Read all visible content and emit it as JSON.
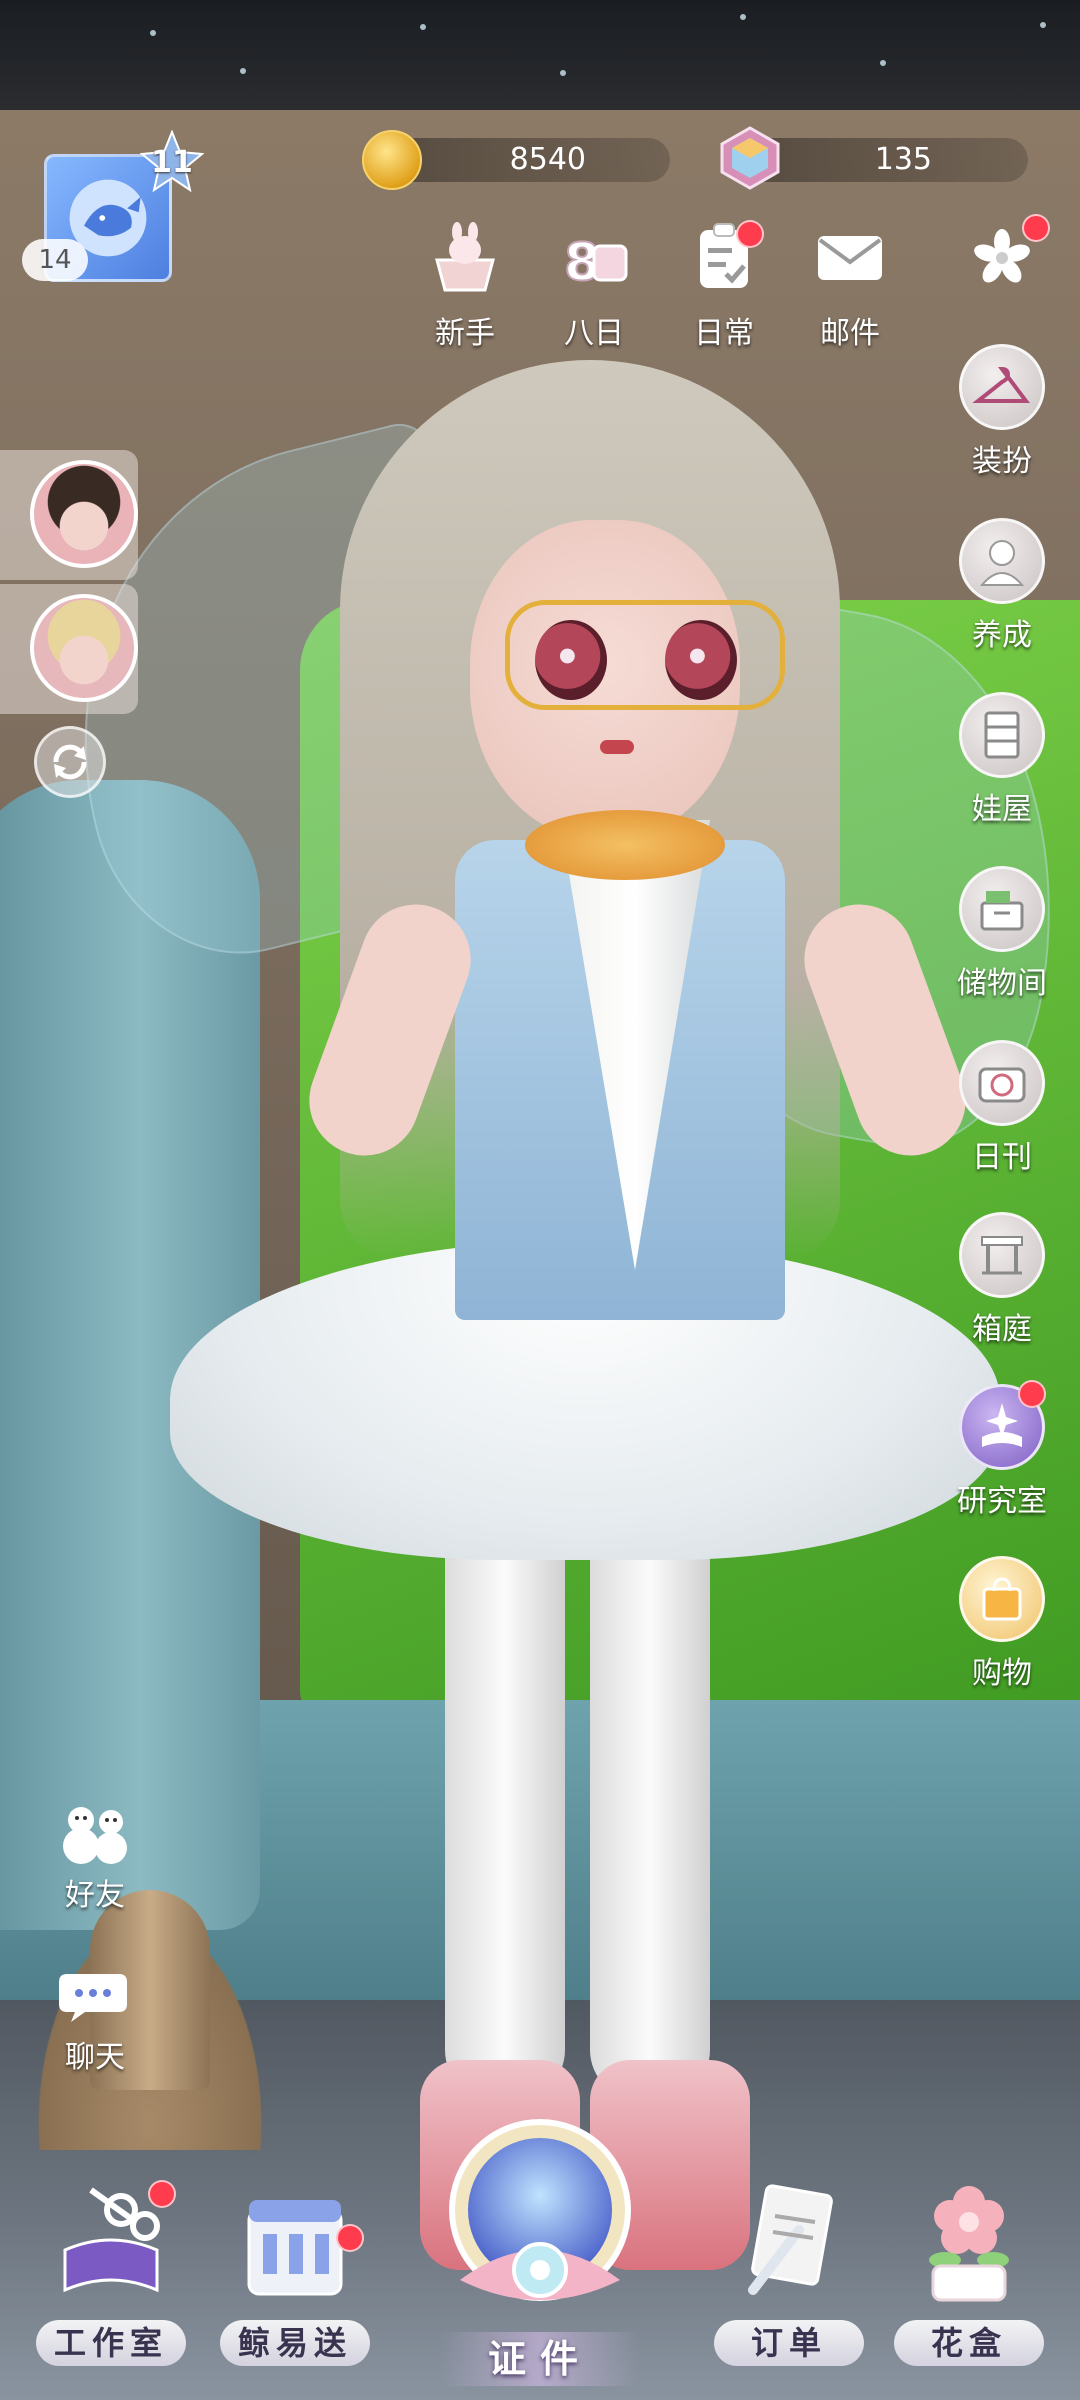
{
  "player": {
    "level": "11",
    "sub_level": "14"
  },
  "currencies": {
    "coins": "8540",
    "gems": "135"
  },
  "top_menu": [
    {
      "label": "新手",
      "icon": "gift-basket-icon",
      "badge": false
    },
    {
      "label": "八日",
      "icon": "eight-day-calendar-icon",
      "badge": false
    },
    {
      "label": "日常",
      "icon": "clipboard-checklist-icon",
      "badge": true
    },
    {
      "label": "邮件",
      "icon": "envelope-icon",
      "badge": false
    }
  ],
  "settings_menu": {
    "icon": "flower-menu-icon",
    "badge": true
  },
  "side_menu": [
    {
      "label": "装扮",
      "icon": "hanger-icon",
      "badge": false
    },
    {
      "label": "养成",
      "icon": "doll-bust-icon",
      "badge": false
    },
    {
      "label": "娃屋",
      "icon": "cabinet-icon",
      "badge": false
    },
    {
      "label": "储物间",
      "icon": "storage-box-icon",
      "badge": false
    },
    {
      "label": "日刊",
      "icon": "camera-icon",
      "badge": false
    },
    {
      "label": "箱庭",
      "icon": "gazebo-icon",
      "badge": false
    },
    {
      "label": "研究室",
      "icon": "sparkle-book-icon",
      "badge": true
    },
    {
      "label": "购物",
      "icon": "shopping-bag-icon",
      "badge": false
    }
  ],
  "social": {
    "friends_label": "好友",
    "chat_label": "聊天"
  },
  "bottom_dock": {
    "studio_label": "工作室",
    "delivery_label": "鲸易送",
    "certificate_label": "证件",
    "orders_label": "订单",
    "flowerbox_label": "花盒"
  },
  "colors": {
    "badge_red": "#ff3b4e",
    "sofa_green": "#5fb833",
    "sofa_teal": "#6ea3ad"
  }
}
